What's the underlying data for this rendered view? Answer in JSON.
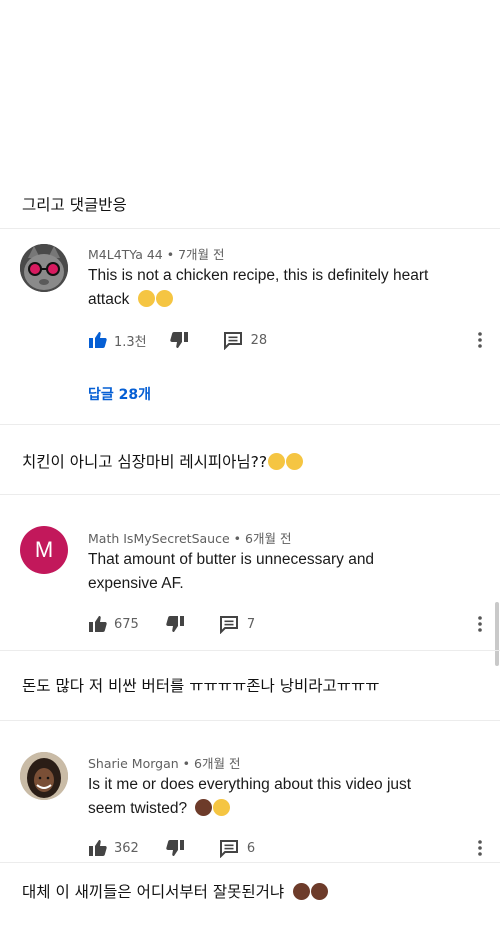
{
  "captions": [
    "그리고 댓글반응",
    "치킨이 아니고 심장마비 레시피아님??",
    "돈도 많다 저 비싼 버터를 ㅠㅠㅠㅠ존나 낭비라고ㅠㅠㅠ",
    "대체 이 새끼들은 어디서부터 잘못된거냐"
  ],
  "comments": [
    {
      "author": "M4L4TYa 44",
      "time": "7개월 전",
      "text_line1": "This is not a chicken recipe, this is definitely heart",
      "text_line2": "attack",
      "avatar_icon": "cat-with-sunglasses-avatar",
      "likes": "1.3천",
      "replies_count": "28",
      "view_replies": "답글 28개",
      "like_active": true
    },
    {
      "author": "Math IsMySecretSauce",
      "time": "6개월 전",
      "text_line1": "That amount of butter is unnecessary and",
      "text_line2": "expensive AF.",
      "avatar_letter": "M",
      "avatar_color": "#c2185b",
      "likes": "675",
      "replies_count": "7"
    },
    {
      "author": "Sharie Morgan",
      "time": "6개월 전",
      "text_line1": "Is it me or does everything about this video just",
      "text_line2": "seem twisted?",
      "avatar_icon": "woman-portrait-avatar",
      "likes": "362",
      "replies_count": "6"
    }
  ],
  "colors": {
    "accent": "#065fd4",
    "text": "#111111",
    "meta": "#606060"
  }
}
